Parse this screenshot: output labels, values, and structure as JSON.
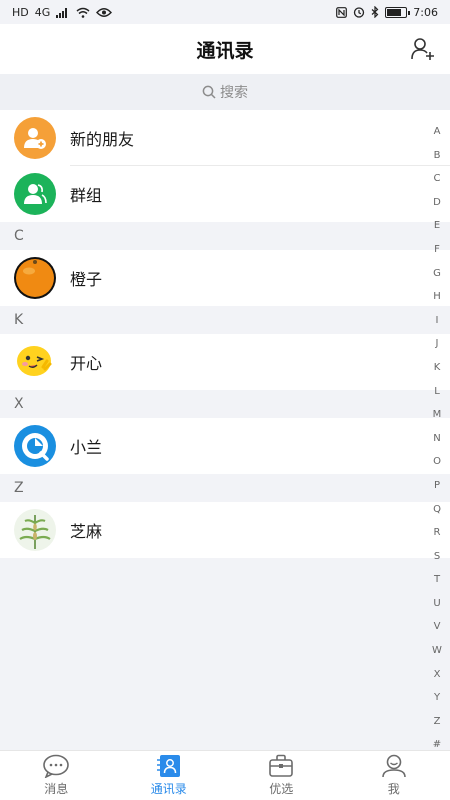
{
  "status_bar": {
    "left_indicators": [
      "HD",
      "4G"
    ],
    "time": "7:06"
  },
  "header": {
    "title": "通讯录"
  },
  "search": {
    "label": "搜索"
  },
  "top_items": [
    {
      "label": "新的朋友",
      "icon": "add-user-icon",
      "color": "#f5a038"
    },
    {
      "label": "群组",
      "icon": "group-icon",
      "color": "#1cb35a"
    }
  ],
  "sections": [
    {
      "letter": "C",
      "contacts": [
        {
          "name": "橙子"
        }
      ]
    },
    {
      "letter": "K",
      "contacts": [
        {
          "name": "开心"
        }
      ]
    },
    {
      "letter": "X",
      "contacts": [
        {
          "name": "小兰"
        }
      ]
    },
    {
      "letter": "Z",
      "contacts": [
        {
          "name": "芝麻"
        }
      ]
    }
  ],
  "index_letters": [
    "A",
    "B",
    "C",
    "D",
    "E",
    "F",
    "G",
    "H",
    "I",
    "J",
    "K",
    "L",
    "M",
    "N",
    "O",
    "P",
    "Q",
    "R",
    "S",
    "T",
    "U",
    "V",
    "W",
    "X",
    "Y",
    "Z",
    "#"
  ],
  "tabs": [
    {
      "label": "消息",
      "icon": "chat-bubble-icon",
      "active": false
    },
    {
      "label": "通讯录",
      "icon": "contacts-icon",
      "active": true
    },
    {
      "label": "优选",
      "icon": "briefcase-icon",
      "active": false
    },
    {
      "label": "我",
      "icon": "profile-icon",
      "active": false
    }
  ],
  "colors": {
    "accent": "#2a8bea",
    "background": "#f2f3f7"
  }
}
